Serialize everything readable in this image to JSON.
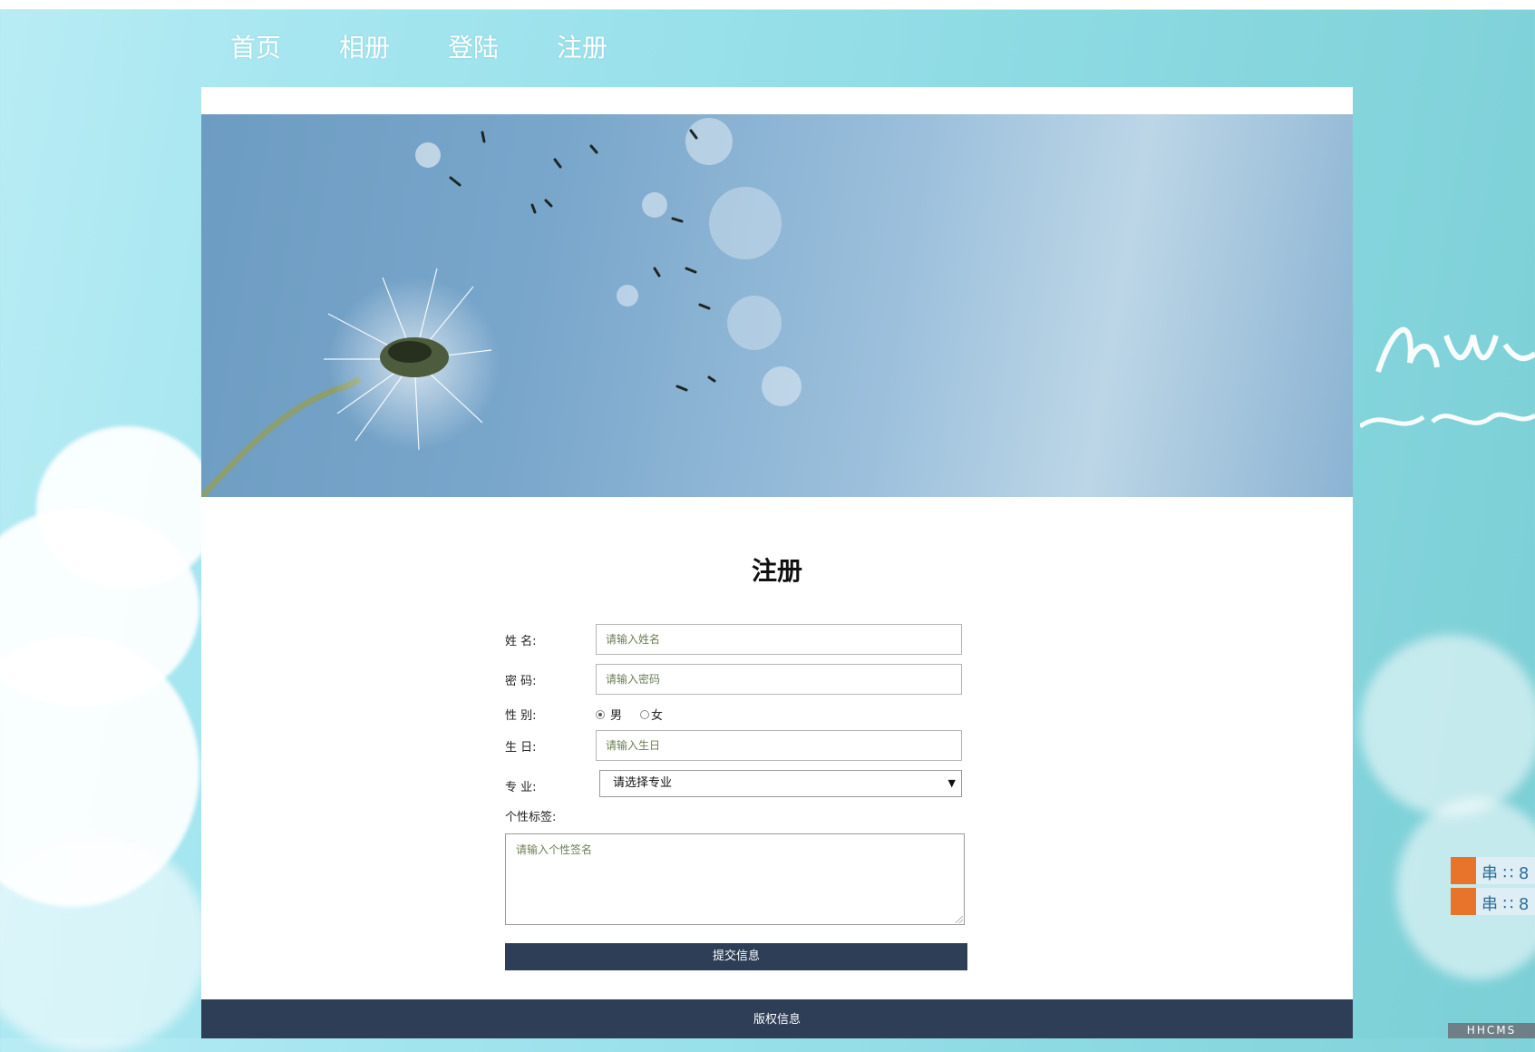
{
  "nav": {
    "items": [
      {
        "label": "首页"
      },
      {
        "label": "相册"
      },
      {
        "label": "登陆"
      },
      {
        "label": "注册"
      }
    ]
  },
  "form": {
    "title": "注册",
    "name": {
      "label": "姓 名:",
      "placeholder": "请输入姓名"
    },
    "password": {
      "label": "密 码:",
      "placeholder": "请输入密码"
    },
    "gender": {
      "label": "性 别:",
      "options": [
        {
          "label": "男",
          "checked": true
        },
        {
          "label": "女",
          "checked": false
        }
      ]
    },
    "birthday": {
      "label": "生 日:",
      "placeholder": "请输入生日"
    },
    "major": {
      "label": "专 业:",
      "selected": "请选择专业"
    },
    "signature": {
      "label": "个性标签:",
      "placeholder": "请输入个性签名"
    },
    "submit": {
      "label": "提交信息"
    }
  },
  "footer": {
    "text": "版权信息"
  },
  "widget": {
    "label": "HHCMS"
  },
  "colors": {
    "nav_text": "#ffffff",
    "button_bg": "#2d3e56",
    "footer_bg": "#2d3e56",
    "page_bg": "#96dfe9"
  },
  "icons": {
    "select_arrow": "chevron-down-icon",
    "resize": "resize-grip-icon"
  }
}
